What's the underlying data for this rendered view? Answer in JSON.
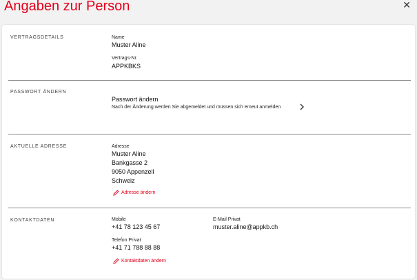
{
  "page": {
    "title": "Angaben zur Person"
  },
  "contract": {
    "label": "VERTRAGSDETAILS",
    "name_label": "Name",
    "name_value": "Muster Aline",
    "number_label": "Vertrags-Nr.",
    "number_value": "APPKBKS"
  },
  "password": {
    "label": "PASSWORT ÄNDERN",
    "title": "Passwort ändern",
    "description": "Nach der Änderung werden Sie abgemeldet und müssen sich erneut anmelden"
  },
  "address": {
    "label": "AKTUELLE ADRESSE",
    "field_label": "Adresse",
    "lines": [
      "Muster Aline",
      "Bankgasse 2",
      "9050 Appenzell",
      "Schweiz"
    ],
    "change_link": "Adresse ändern"
  },
  "contact": {
    "label": "KONTAKTDATEN",
    "mobile_label": "Mobile",
    "mobile_value": "+41 78 123 45 67",
    "email_label": "E-Mail Privat",
    "email_value": "muster.aline@appkb.ch",
    "phone_label": "Telefon Privat",
    "phone_value": "+41 71 788 88 88",
    "change_link": "Kontaktdaten ändern"
  },
  "colors": {
    "accent": "#e2001a"
  }
}
